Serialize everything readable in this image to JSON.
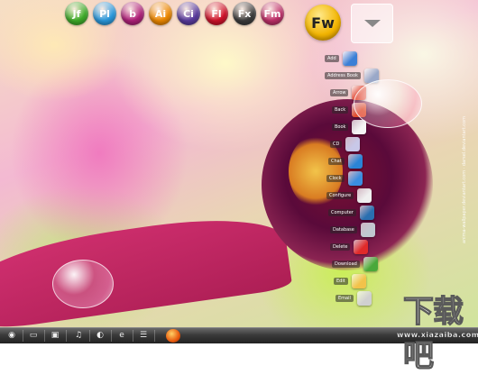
{
  "top_dock": {
    "icons": [
      {
        "label": "Jf",
        "name": "jf-app-icon",
        "color": "#3fae2a"
      },
      {
        "label": "Pl",
        "name": "pl-app-icon",
        "color": "#2b9be0"
      },
      {
        "label": "b",
        "name": "b-app-icon",
        "color": "#b0207a"
      },
      {
        "label": "Ai",
        "name": "illustrator-icon",
        "color": "#f08a00"
      },
      {
        "label": "Ci",
        "name": "ci-app-icon",
        "color": "#5a3ca0"
      },
      {
        "label": "Fl",
        "name": "flash-icon",
        "color": "#d1122a"
      },
      {
        "label": "Fx",
        "name": "fx-app-icon",
        "color": "#3c3c3c"
      },
      {
        "label": "Fm",
        "name": "fm-app-icon",
        "color": "#c0306a"
      }
    ],
    "fw_label": "Fw",
    "fw_color": "#f2b400"
  },
  "launcher": {
    "items": [
      {
        "label": "Add",
        "name": "add",
        "color": "#3b7fd6"
      },
      {
        "label": "Address Book",
        "name": "address-book",
        "color": "#9aa8c8"
      },
      {
        "label": "Arrow",
        "name": "arrow",
        "color": "#e0402a"
      },
      {
        "label": "Back",
        "name": "back",
        "color": "#e04a2a"
      },
      {
        "label": "Book",
        "name": "book",
        "color": "#f5f5f5"
      },
      {
        "label": "CD",
        "name": "cd",
        "color": "#c8c8e8"
      },
      {
        "label": "Chat",
        "name": "chat",
        "color": "#2a84d6"
      },
      {
        "label": "Clock",
        "name": "clock",
        "color": "#3a8ee0"
      },
      {
        "label": "Configure",
        "name": "configure",
        "color": "#f0f0f0"
      },
      {
        "label": "Computer",
        "name": "computer",
        "color": "#2a6fb0"
      },
      {
        "label": "Database",
        "name": "database",
        "color": "#c0c8d0"
      },
      {
        "label": "Delete",
        "name": "delete",
        "color": "#e02a2a"
      },
      {
        "label": "Download",
        "name": "download",
        "color": "#4aa83a"
      },
      {
        "label": "Edit",
        "name": "edit",
        "color": "#f2c24a"
      },
      {
        "label": "Email",
        "name": "email",
        "color": "#d0d0d0"
      }
    ]
  },
  "credit_text": "anima-wallpaper.deviantart.com · darsel.deviantart.com",
  "taskbar": {
    "buttons": [
      {
        "icon": "◉",
        "name": "start-button"
      },
      {
        "icon": "▭",
        "name": "folder-task-button"
      },
      {
        "icon": "▣",
        "name": "window-task-button"
      },
      {
        "icon": "♫",
        "name": "music-task-button"
      },
      {
        "icon": "◐",
        "name": "media-task-button"
      },
      {
        "icon": "e",
        "name": "ie-task-button"
      },
      {
        "icon": "☰",
        "name": "list-task-button"
      }
    ]
  },
  "watermark": {
    "text": "下载吧",
    "url": "www.xiazaiba.com"
  }
}
